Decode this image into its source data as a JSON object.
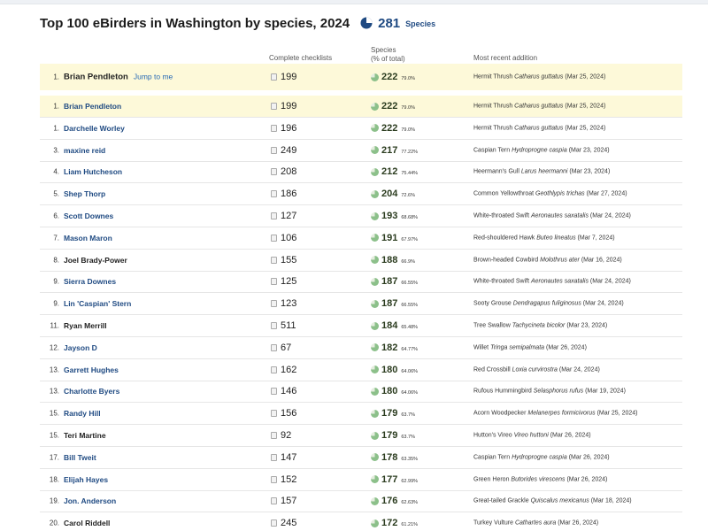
{
  "header": {
    "title": "Top 100 eBirders in Washington by species, 2024",
    "total_species": "281",
    "total_species_label": "Species"
  },
  "columns": {
    "checklists": "Complete checklists",
    "species_line1": "Species",
    "species_line2": "(% of total)",
    "recent": "Most recent addition"
  },
  "colors": {
    "link": "#1f4a82",
    "highlight_bg": "#fdf9d9",
    "species_icon": "#8cc08a"
  },
  "me_row": {
    "rank": "1.",
    "name": "Brian Pendleton",
    "jump_label": "Jump to me",
    "checklists": "199",
    "species": "222",
    "pct": "79.0%",
    "common": "Hermit Thrush",
    "sci": "Catharus guttatus",
    "date": "(Mar 25, 2024)"
  },
  "rows": [
    {
      "rank": "1.",
      "name": "Brian Pendleton",
      "checklists": "199",
      "species": "222",
      "pct": "79.0%",
      "common": "Hermit Thrush",
      "sci": "Catharus guttatus",
      "date": "(Mar 25, 2024)",
      "highlight": true
    },
    {
      "rank": "1.",
      "name": "Darchelle Worley",
      "checklists": "196",
      "species": "222",
      "pct": "79.0%",
      "common": "Hermit Thrush",
      "sci": "Catharus guttatus",
      "date": "(Mar 25, 2024)"
    },
    {
      "rank": "3.",
      "name": "maxine reid",
      "checklists": "249",
      "species": "217",
      "pct": "77.22%",
      "common": "Caspian Tern",
      "sci": "Hydroprogne caspia",
      "date": "(Mar 23, 2024)"
    },
    {
      "rank": "4.",
      "name": "Liam Hutcheson",
      "checklists": "208",
      "species": "212",
      "pct": "75.44%",
      "common": "Heermann's Gull",
      "sci": "Larus heermanni",
      "date": "(Mar 23, 2024)"
    },
    {
      "rank": "5.",
      "name": "Shep Thorp",
      "checklists": "186",
      "species": "204",
      "pct": "72.6%",
      "common": "Common Yellowthroat",
      "sci": "Geothlypis trichas",
      "date": "(Mar 27, 2024)"
    },
    {
      "rank": "6.",
      "name": "Scott Downes",
      "checklists": "127",
      "species": "193",
      "pct": "68.68%",
      "common": "White-throated Swift",
      "sci": "Aeronautes saxatalis",
      "date": "(Mar 24, 2024)"
    },
    {
      "rank": "7.",
      "name": "Mason Maron",
      "checklists": "106",
      "species": "191",
      "pct": "67.97%",
      "common": "Red-shouldered Hawk",
      "sci": "Buteo lineatus",
      "date": "(Mar 7, 2024)"
    },
    {
      "rank": "8.",
      "name": "Joel Brady-Power",
      "checklists": "155",
      "species": "188",
      "pct": "66.9%",
      "common": "Brown-headed Cowbird",
      "sci": "Molothrus ater",
      "date": "(Mar 16, 2024)",
      "dark": true
    },
    {
      "rank": "9.",
      "name": "Sierra Downes",
      "checklists": "125",
      "species": "187",
      "pct": "66.55%",
      "common": "White-throated Swift",
      "sci": "Aeronautes saxatalis",
      "date": "(Mar 24, 2024)"
    },
    {
      "rank": "9.",
      "name": "Lin 'Caspian' Stern",
      "checklists": "123",
      "species": "187",
      "pct": "66.55%",
      "common": "Sooty Grouse",
      "sci": "Dendragapus fuliginosus",
      "date": "(Mar 24, 2024)"
    },
    {
      "rank": "11.",
      "name": "Ryan Merrill",
      "checklists": "511",
      "species": "184",
      "pct": "65.48%",
      "common": "Tree Swallow",
      "sci": "Tachycineta bicolor",
      "date": "(Mar 23, 2024)",
      "dark": true
    },
    {
      "rank": "12.",
      "name": "Jayson D",
      "checklists": "67",
      "species": "182",
      "pct": "64.77%",
      "common": "Willet",
      "sci": "Tringa semipalmata",
      "date": "(Mar 26, 2024)"
    },
    {
      "rank": "13.",
      "name": "Garrett Hughes",
      "checklists": "162",
      "species": "180",
      "pct": "64.06%",
      "common": "Red Crossbill",
      "sci": "Loxia curvirostra",
      "date": "(Mar 24, 2024)"
    },
    {
      "rank": "13.",
      "name": "Charlotte Byers",
      "checklists": "146",
      "species": "180",
      "pct": "64.06%",
      "common": "Rufous Hummingbird",
      "sci": "Selasphorus rufus",
      "date": "(Mar 19, 2024)"
    },
    {
      "rank": "15.",
      "name": "Randy Hill",
      "checklists": "156",
      "species": "179",
      "pct": "63.7%",
      "common": "Acorn Woodpecker",
      "sci": "Melanerpes formicivorus",
      "date": "(Mar 25, 2024)"
    },
    {
      "rank": "15.",
      "name": "Teri Martine",
      "checklists": "92",
      "species": "179",
      "pct": "63.7%",
      "common": "Hutton's Vireo",
      "sci": "Vireo huttoni",
      "date": "(Mar 26, 2024)",
      "dark": true
    },
    {
      "rank": "17.",
      "name": "Bill Tweit",
      "checklists": "147",
      "species": "178",
      "pct": "63.35%",
      "common": "Caspian Tern",
      "sci": "Hydroprogne caspia",
      "date": "(Mar 26, 2024)"
    },
    {
      "rank": "18.",
      "name": "Elijah Hayes",
      "checklists": "152",
      "species": "177",
      "pct": "62.99%",
      "common": "Green Heron",
      "sci": "Butorides virescens",
      "date": "(Mar 26, 2024)"
    },
    {
      "rank": "19.",
      "name": "Jon. Anderson",
      "checklists": "157",
      "species": "176",
      "pct": "62.63%",
      "common": "Great-tailed Grackle",
      "sci": "Quiscalus mexicanus",
      "date": "(Mar 18, 2024)"
    },
    {
      "rank": "20.",
      "name": "Carol Riddell",
      "checklists": "245",
      "species": "172",
      "pct": "61.21%",
      "common": "Turkey Vulture",
      "sci": "Cathartes aura",
      "date": "(Mar 26, 2024)",
      "dark": true
    }
  ]
}
